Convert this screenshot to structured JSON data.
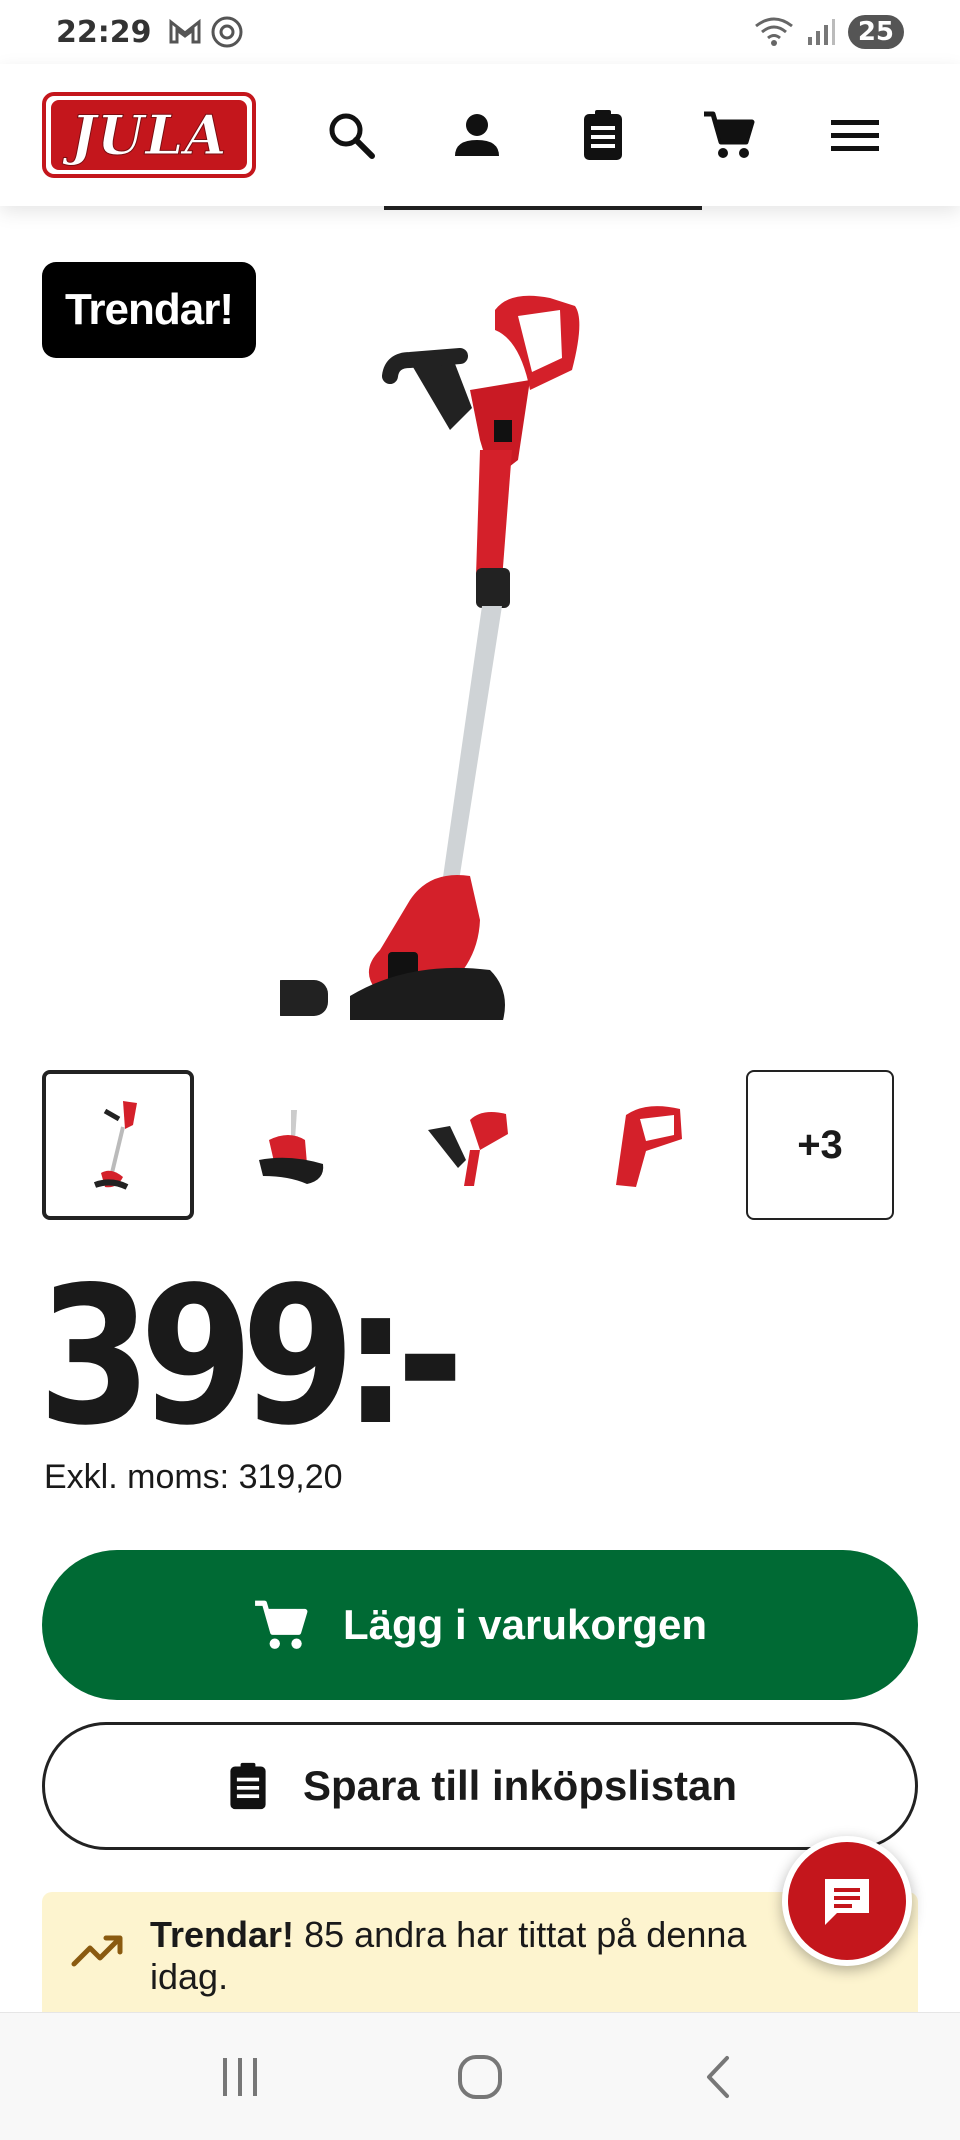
{
  "status": {
    "time": "22:29",
    "battery": "25"
  },
  "header": {
    "logo_text": "JULA",
    "icons": [
      "search-icon",
      "account-icon",
      "shopping-list-icon",
      "cart-icon",
      "menu-icon"
    ]
  },
  "product": {
    "badge": "Trendar!",
    "thumbnail_more": "+3",
    "price": "399:-",
    "price_excl_vat": "Exkl. moms: 319,20"
  },
  "actions": {
    "add_to_cart": "Lägg i varukorgen",
    "save_to_list": "Spara till inköpslistan"
  },
  "trend_info": {
    "label": "Trendar!",
    "text": "85 andra har tittat på denna idag."
  },
  "colors": {
    "brand_red": "#c4161c",
    "cart_green": "#006a34",
    "trend_bg": "#fdf4cf"
  }
}
